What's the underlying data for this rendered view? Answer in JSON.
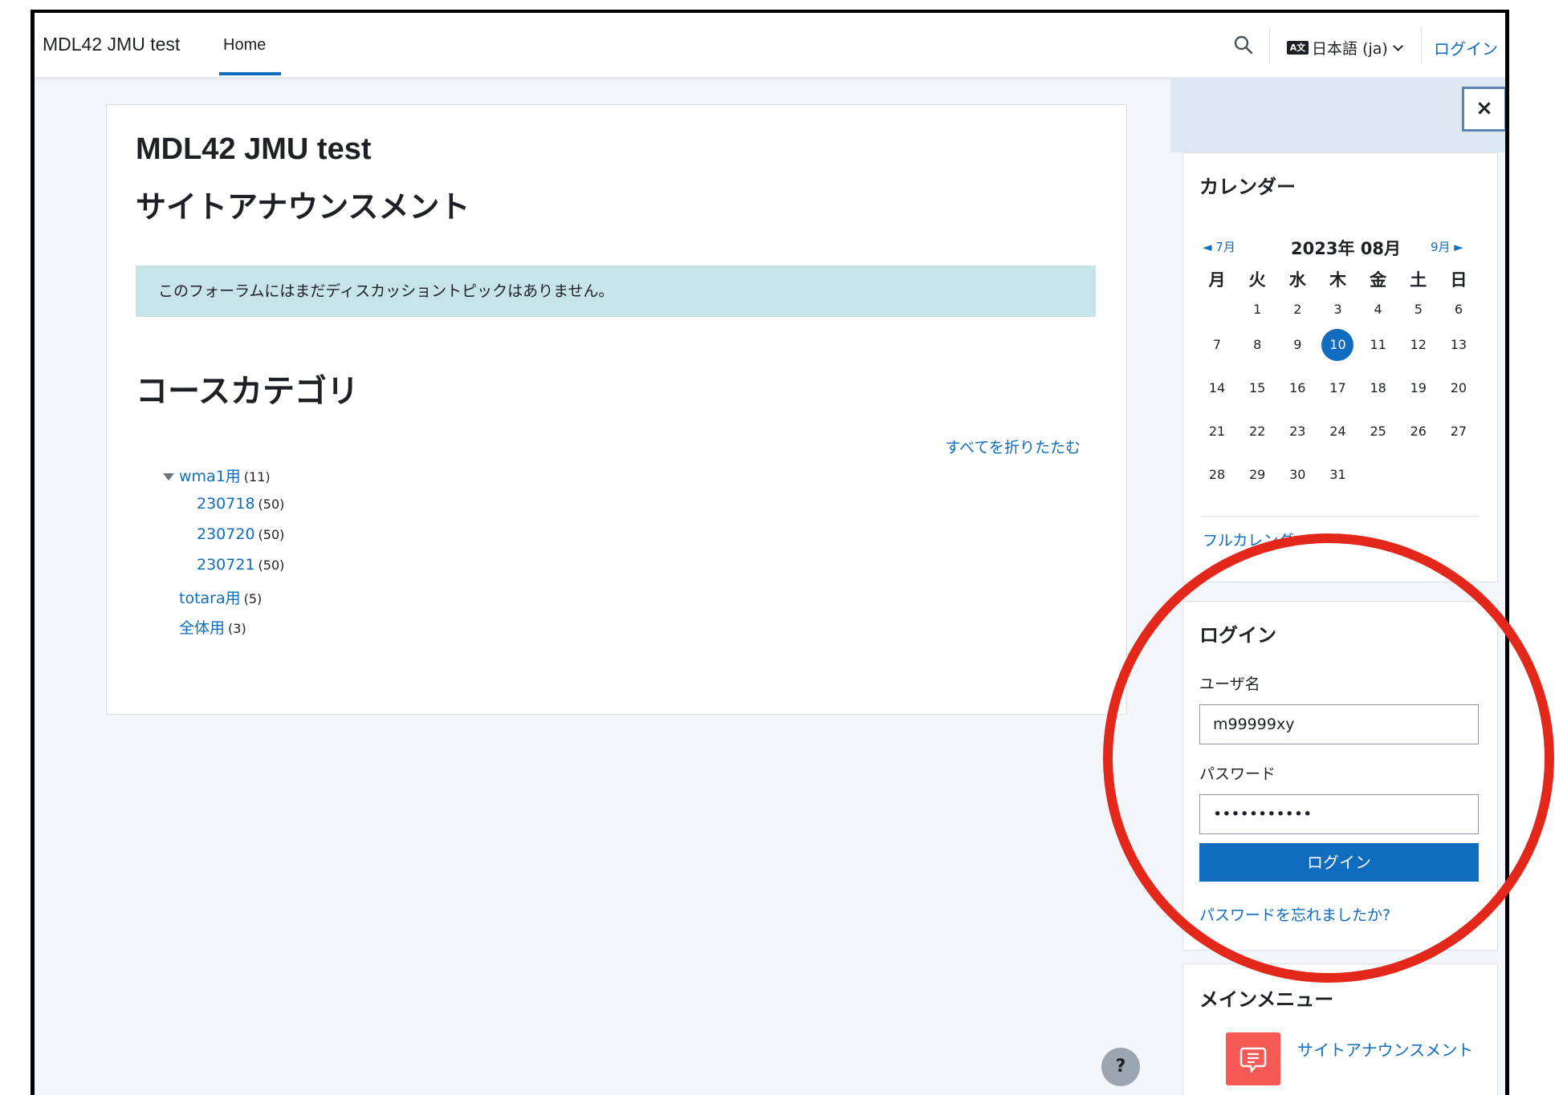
{
  "navbar": {
    "site_name": "MDL42 JMU test",
    "home": "Home",
    "language": "日本語 (ja)",
    "language_icon_text": "A文",
    "login": "ログイン"
  },
  "main": {
    "site_title": "MDL42 JMU test",
    "announcements_heading": "サイトアナウンスメント",
    "no_discussion_notice": "このフォーラムにはまだディスカッショントピックはありません。",
    "categories_heading": "コースカテゴリ",
    "collapse_all": "すべてを折りたたむ",
    "categories": [
      {
        "name": "wma1用",
        "count": "(11)",
        "level": 0,
        "expanded": true
      },
      {
        "name": "230718",
        "count": "(50)",
        "level": 1
      },
      {
        "name": "230720",
        "count": "(50)",
        "level": 1
      },
      {
        "name": "230721",
        "count": "(50)",
        "level": 1
      },
      {
        "name": "totara用",
        "count": "(5)",
        "level": 0
      },
      {
        "name": "全体用",
        "count": "(3)",
        "level": 0
      }
    ]
  },
  "help": {
    "label": "?"
  },
  "drawer": {
    "close_label": "×"
  },
  "calendar": {
    "title": "カレンダー",
    "prev": "◄ 7月",
    "next": "9月 ►",
    "month": "2023年 08月",
    "weekdays": [
      "月",
      "火",
      "水",
      "木",
      "金",
      "土",
      "日"
    ],
    "weeks": [
      [
        "",
        "1",
        "2",
        "3",
        "4",
        "5",
        "6"
      ],
      [
        "7",
        "8",
        "9",
        "10",
        "11",
        "12",
        "13"
      ],
      [
        "14",
        "15",
        "16",
        "17",
        "18",
        "19",
        "20"
      ],
      [
        "21",
        "22",
        "23",
        "24",
        "25",
        "26",
        "27"
      ],
      [
        "28",
        "29",
        "30",
        "31",
        "",
        "",
        ""
      ]
    ],
    "today": "10",
    "full_calendar": "フルカレンダー"
  },
  "login": {
    "title": "ログイン",
    "username_label": "ユーザ名",
    "username_value": "m99999xy",
    "password_label": "パスワード",
    "password_value": "•••••••••••",
    "button": "ログイン",
    "forgot": "パスワードを忘れましたか?"
  },
  "main_menu": {
    "title": "メインメニュー",
    "item": "サイトアナウンスメント"
  },
  "colors": {
    "accent": "#0f6cbf",
    "notice_bg": "#c7e4e8",
    "annotation_circle": "#e3281b",
    "forum_icon_bg": "#f65954"
  }
}
